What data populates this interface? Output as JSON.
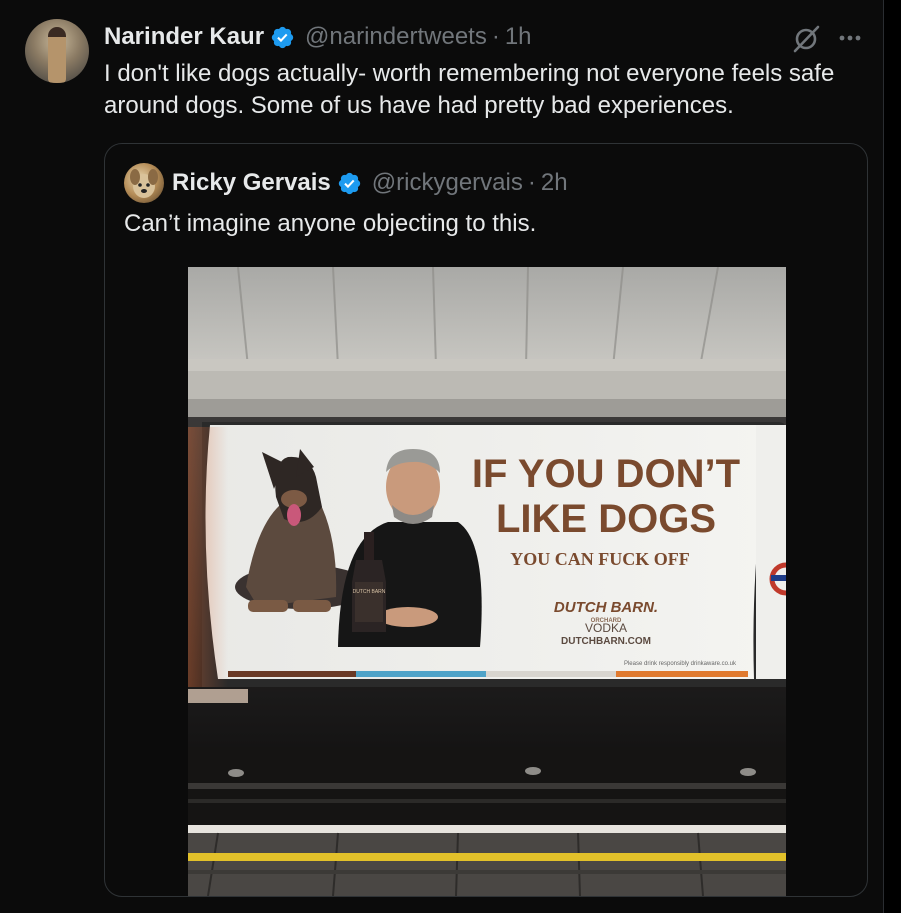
{
  "tweet": {
    "author_name": "Narinder Kaur",
    "handle": "@narindertweets",
    "separator": "·",
    "time": "1h",
    "text": "I don't like dogs actually- worth remembering not everyone feels safe around dogs. Some of us have had pretty bad experiences."
  },
  "quoted": {
    "author_name": "Ricky Gervais",
    "handle": "@rickygervais",
    "separator": "·",
    "time": "2h",
    "text": "Can’t imagine anyone objecting to this."
  },
  "ad": {
    "headline_1": "IF YOU DON’T",
    "headline_2": "LIKE DOGS",
    "subline": "YOU CAN FUCK OFF",
    "brand_1": "DUTCH BARN.",
    "brand_2": "ORCHARD",
    "product": "VODKA",
    "website": "DUTCHBARN.COM",
    "bottle_label": "DUTCH BARN",
    "disclaimer": "Please drink responsibly drinkaware.co.uk"
  },
  "colors": {
    "background": "#0b0b0b",
    "text_primary": "#e7e9ea",
    "text_secondary": "#71767b",
    "verified_blue": "#1d9bf0",
    "ad_brown": "#7a4a2e"
  },
  "icons": {
    "verified": "verified-badge-icon",
    "grok": "grok-icon",
    "more": "more-icon"
  }
}
